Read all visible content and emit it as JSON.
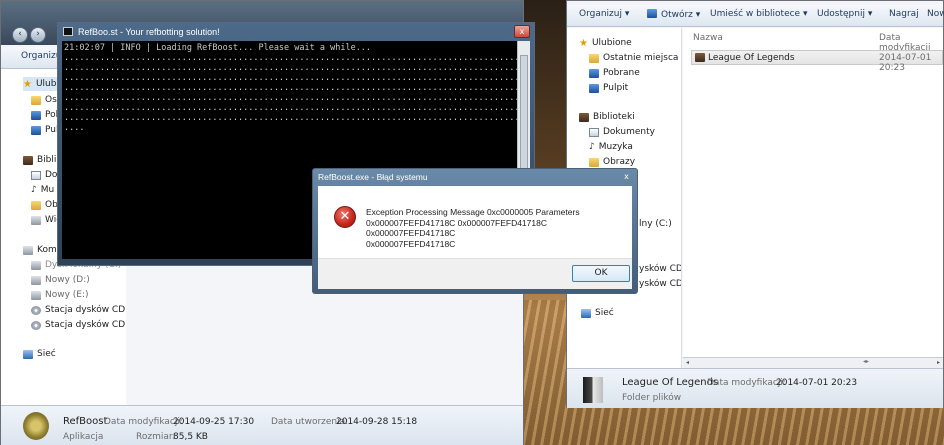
{
  "console": {
    "title": "RefBoo.st - Your refbotting solution!",
    "close_glyph": "x",
    "first_line": "21:02:07 | INFO | Loading RefBoost... Please wait a while...",
    "dots_line": "..........................................................................................",
    "last_line": "...."
  },
  "dialog": {
    "title": "RefBoost.exe - Błąd systemu",
    "close_glyph": "x",
    "message_line1": "Exception Processing Message 0xc0000005 Parameters",
    "message_line2": "0x000007FEFD41718C 0x000007FEFD41718C 0x000007FEFD41718C",
    "message_line3": "0x000007FEFD41718C",
    "ok_label": "OK",
    "icon": "error-x-icon"
  },
  "left_explorer": {
    "toolbar_label": "Organizuj",
    "nav": {
      "favorites_label": "Ulubione",
      "fav_items": [
        "Ost",
        "Pob",
        "Pul"
      ],
      "libraries_label": "Bibli",
      "lib_items": [
        "Dol",
        "Mu",
        "Obr",
        "Wid"
      ],
      "computer_label": "Komp",
      "drives": [
        "Dysk lokalny (C:)",
        "Nowy (D:)",
        "Nowy (E:)",
        "Stacja dysków CD (G:",
        "Stacja dysków CD (H"
      ],
      "network_label": "Sieć"
    },
    "status": {
      "name": "RefBoost",
      "modified_label": "Data modyfikacji:",
      "modified_value": "2014-09-25 17:30",
      "created_label": "Data utworzenia:",
      "created_value": "2014-09-28 15:18",
      "type": "Aplikacja",
      "size_label": "Rozmiar:",
      "size_value": "85,5 KB"
    }
  },
  "right_explorer": {
    "toolbar": [
      "Organizuj",
      "Otwórz",
      "Umieść w bibliotece",
      "Udostępnij",
      "Nagraj",
      "Nowy"
    ],
    "columns": {
      "name": "Nazwa",
      "modified": "Data modyfikacji"
    },
    "nav": {
      "favorites_label": "Ulubione",
      "fav_items": [
        "Ostatnie miejsca",
        "Pobrane",
        "Pulpit"
      ],
      "libraries_label": "Biblioteki",
      "lib_items": [
        "Dokumenty",
        "Muzyka",
        "Obrazy"
      ],
      "partial_items": [
        "lny (C:)",
        "ysków CD (G",
        "ysków CD (H"
      ],
      "network_label": "Sieć"
    },
    "file": {
      "name": "League Of Legends",
      "modified": "2014-07-01 20:23"
    },
    "status": {
      "name": "League Of Legends",
      "modified_label": "Data modyfikacji:",
      "modified_value": "2014-07-01 20:23",
      "type": "Folder plików"
    }
  },
  "colors": {
    "accent": "#1e395b",
    "error": "#c4241a",
    "console_bg": "#000000"
  }
}
